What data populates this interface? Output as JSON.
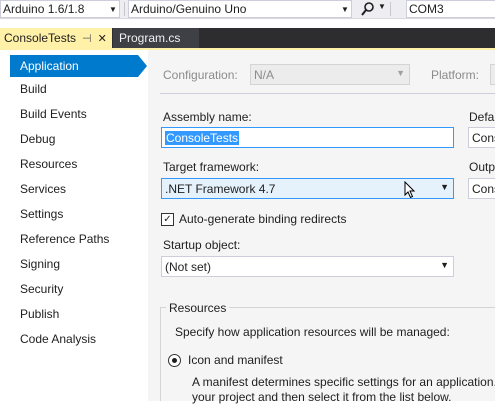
{
  "toolbar": {
    "board_version": "Arduino 1.6/1.8",
    "board": "Arduino/Genuino Uno",
    "port": "COM3",
    "search_icon": "search-icon"
  },
  "tabs": [
    {
      "label": "ConsoleTests",
      "active": true
    },
    {
      "label": "Program.cs",
      "active": false
    }
  ],
  "nav": {
    "items": [
      "Application",
      "Build",
      "Build Events",
      "Debug",
      "Resources",
      "Services",
      "Settings",
      "Reference Paths",
      "Signing",
      "Security",
      "Publish",
      "Code Analysis"
    ],
    "active": "Application"
  },
  "main": {
    "configuration_label": "Configuration:",
    "configuration_value": "N/A",
    "platform_label": "Platform:",
    "assembly_name_label": "Assembly name:",
    "assembly_name_value": "ConsoleTests",
    "default_namespace_label": "Defa",
    "default_namespace_value": "Conso",
    "target_framework_label": "Target framework:",
    "target_framework_value": ".NET Framework 4.7",
    "output_type_label": "Outp",
    "output_type_value": "Cons",
    "auto_binding_label": "Auto-generate binding redirects",
    "auto_binding_checked": true,
    "startup_object_label": "Startup object:",
    "startup_object_value": "(Not set)",
    "resources_group_label": "Resources",
    "resources_desc": "Specify how application resources will be managed:",
    "icon_manifest_label": "Icon and manifest",
    "manifest_desc_line1": "A manifest determines specific settings for an application.",
    "manifest_desc_line2": "your project and then select it from the list below."
  },
  "colors": {
    "accent": "#007acc",
    "tab_active": "#fff1a8",
    "tabstrip_bg": "#2d2d30",
    "panel_bg": "#f5f5f5"
  }
}
